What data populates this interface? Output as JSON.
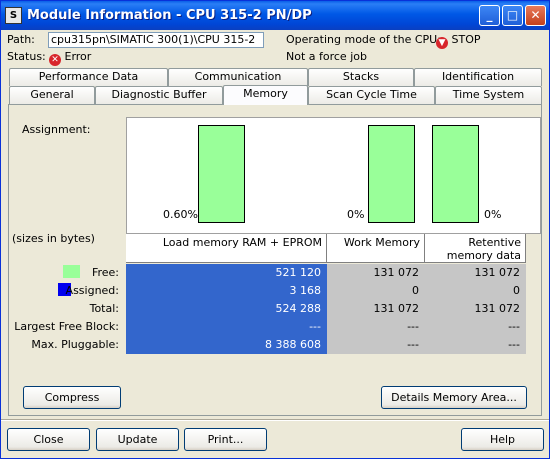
{
  "window": {
    "title": "Module Information - CPU 315-2 PN/DP",
    "app_icon_text": "S",
    "minimize": "_",
    "maximize": "□",
    "close": "✕"
  },
  "header": {
    "path_label": "Path:",
    "path_value": "cpu315pn\\SIMATIC 300(1)\\CPU 315-2 PN/",
    "mode_label": "Operating mode of the  CPU:",
    "mode_icon": "stop-icon",
    "mode_value": "STOP",
    "status_label": "Status:",
    "status_icon": "error-icon",
    "status_value": "Error",
    "force_job": "Not a force job"
  },
  "tabs": {
    "row1": [
      "Performance Data",
      "Communication",
      "Stacks",
      "Identification"
    ],
    "row2": [
      "General",
      "Diagnostic Buffer",
      "Memory",
      "Scan Cycle Time",
      "Time System"
    ],
    "active": "Memory"
  },
  "memory": {
    "assignment_label": "Assignment:",
    "sizes_label": "(sizes in bytes)",
    "bars": [
      {
        "label": "0.60%",
        "assigned_fraction": 0.006
      },
      {
        "label": "0%",
        "assigned_fraction": 0.0
      },
      {
        "label": "0%",
        "assigned_fraction": 0.0
      }
    ],
    "columns": [
      "Load memory RAM + EPROM",
      "Work Memory",
      "Retentive memory data"
    ],
    "row_labels": [
      "Free:",
      "Assigned:",
      "Total:",
      "Largest Free Block:",
      "Max. Pluggable:"
    ],
    "rows": [
      [
        "521 120",
        "131 072",
        "131 072"
      ],
      [
        "3 168",
        "0",
        "0"
      ],
      [
        "524 288",
        "131 072",
        "131 072"
      ],
      [
        "---",
        "---",
        "---"
      ],
      [
        "8 388 608",
        "---",
        "---"
      ]
    ],
    "colors": {
      "free": "#99ff99",
      "assigned": "#0000ee",
      "load_column": "#3366cc",
      "other_columns": "#c6c6c6"
    }
  },
  "buttons": {
    "compress": "Compress",
    "details": "Details Memory Area...",
    "close": "Close",
    "update": "Update",
    "print": "Print...",
    "help": "Help"
  }
}
